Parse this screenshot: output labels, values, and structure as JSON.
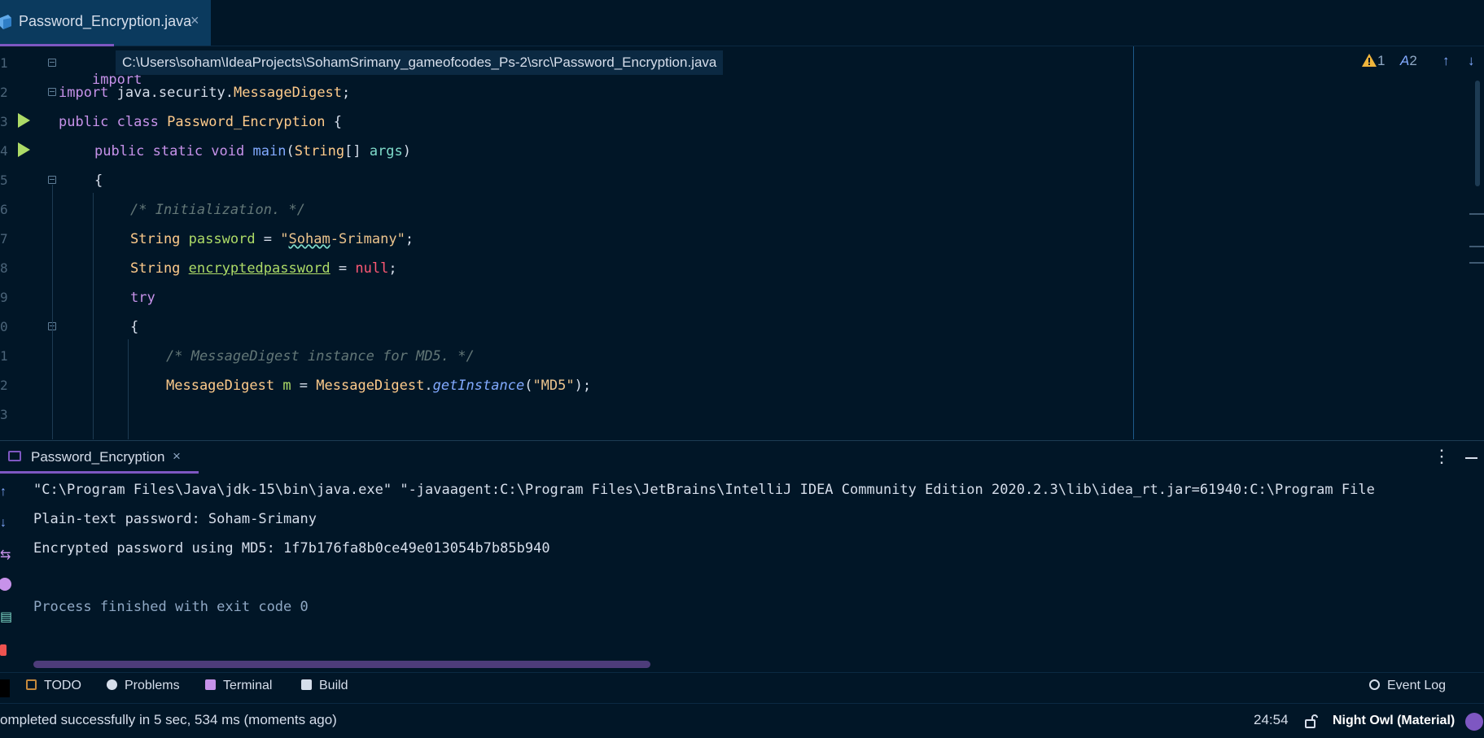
{
  "editor_tab": {
    "label": "Password_Encryption.java",
    "close": "×"
  },
  "path_tooltip": "C:\\Users\\soham\\IdeaProjects\\SohamSrimany_gameofcodes_Ps-2\\src\\Password_Encryption.java",
  "inspections": {
    "warnings": "1",
    "typos": "2"
  },
  "gutter": [
    "1",
    "2",
    "3",
    "4",
    "5",
    "6",
    "7",
    "8",
    "9",
    "0",
    "1",
    "2",
    "3"
  ],
  "code": {
    "l1_kw": "import",
    "l2_kw": "import",
    "l2_pkg": "java.security.",
    "l2_cls": "MessageDigest",
    "l2_end": ";",
    "l3_mods": "public class",
    "l3_name": "Password_Encryption",
    "l3_end": " {",
    "l4_mods": "public static void",
    "l4_fn": "main",
    "l4_p1": "(",
    "l4_type": "String",
    "l4_p2": "[] ",
    "l4_arg": "args",
    "l4_p3": ")",
    "l5": "{",
    "l6": "/* Initialization. */",
    "l7_type": "String",
    "l7_var": "password",
    "l7_eq": " = ",
    "l7_q1": "\"",
    "l7_typo": "Soham",
    "l7_rest": "-Srimany\"",
    "l7_end": ";",
    "l8_type": "String",
    "l8_var": "encryptedpassword",
    "l8_eq": " = ",
    "l8_null": "null",
    "l8_end": ";",
    "l9": "try",
    "l10": "{",
    "l11": "/* MessageDigest instance for MD5. */",
    "l12_type": "MessageDigest",
    "l12_var": "m",
    "l12_eq": " = ",
    "l12_cls": "MessageDigest",
    "l12_dot": ".",
    "l12_fn": "getInstance",
    "l12_p1": "(",
    "l12_str": "\"MD5\"",
    "l12_end": ");"
  },
  "run_tab": {
    "label": "Password_Encryption",
    "close": "×"
  },
  "console": [
    "\"C:\\Program Files\\Java\\jdk-15\\bin\\java.exe\" \"-javaagent:C:\\Program Files\\JetBrains\\IntelliJ IDEA Community Edition 2020.2.3\\lib\\idea_rt.jar=61940:C:\\Program File",
    "Plain-text password: Soham-Srimany",
    "Encrypted password using MD5: 1f7b176fa8b0ce49e013054b7b85b940",
    "Process finished with exit code 0"
  ],
  "tool_windows": {
    "todo": "TODO",
    "problems": "Problems",
    "terminal": "Terminal",
    "build": "Build",
    "event_log": "Event Log"
  },
  "status": {
    "message": "ompleted successfully in 5 sec, 534 ms (moments ago)",
    "position": "24:54",
    "theme": "Night Owl (Material)"
  },
  "colors": {
    "background": "#011627",
    "accent": "#7e57c2",
    "tab_active": "#0b3a5e"
  }
}
